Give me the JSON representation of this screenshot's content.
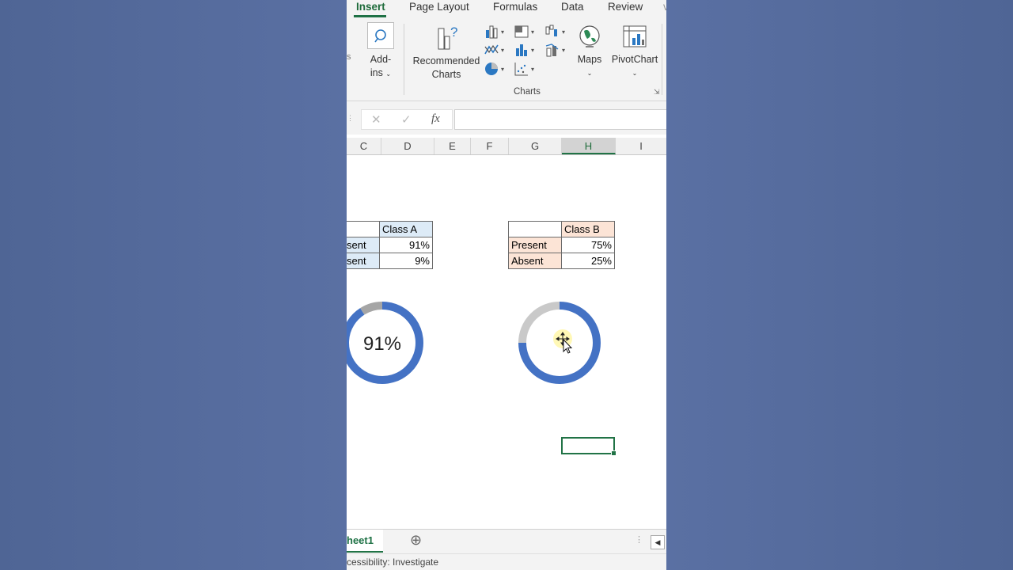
{
  "ribbon": {
    "tabs": [
      {
        "label": "Insert",
        "active": true
      },
      {
        "label": "Page Layout",
        "active": false
      },
      {
        "label": "Formulas",
        "active": false
      },
      {
        "label": "Data",
        "active": false
      },
      {
        "label": "Review",
        "active": false
      }
    ],
    "addins_label_1": "Add-",
    "addins_label_2": "ins",
    "recommended_label_1": "Recommended",
    "recommended_label_2": "Charts",
    "maps_label": "Maps",
    "pivotchart_label": "PivotChart",
    "group_charts": "Charts",
    "accent": "#1e7145"
  },
  "formula_bar": {
    "cancel": "✕",
    "enter": "✓",
    "fx": "fx",
    "value": ""
  },
  "columns": [
    "C",
    "D",
    "E",
    "F",
    "G",
    "H",
    "I"
  ],
  "selected_column": "H",
  "table_a": {
    "header": "Class A",
    "rows": [
      {
        "label": "sent",
        "value": "91%"
      },
      {
        "label": "sent",
        "value": "9%"
      }
    ],
    "header_color": "#ddebf7",
    "label_color": "#ddebf7"
  },
  "table_b": {
    "header": "Class B",
    "rows": [
      {
        "label": "Present",
        "value": "75%"
      },
      {
        "label": "Absent",
        "value": "25%"
      }
    ],
    "header_color": "#fce4d6",
    "label_color": "#fce4d6"
  },
  "donut_a": {
    "present": 91,
    "absent": 9,
    "center_label": "91%",
    "present_color": "#4472c4",
    "absent_color": "#a5a5a5"
  },
  "donut_b": {
    "present": 75,
    "absent": 25,
    "present_color": "#4472c4",
    "absent_color": "#c9c9c9"
  },
  "sheet_tab": "heet1",
  "add_sheet": "⊕",
  "status_text": "cessibility: Investigate"
}
